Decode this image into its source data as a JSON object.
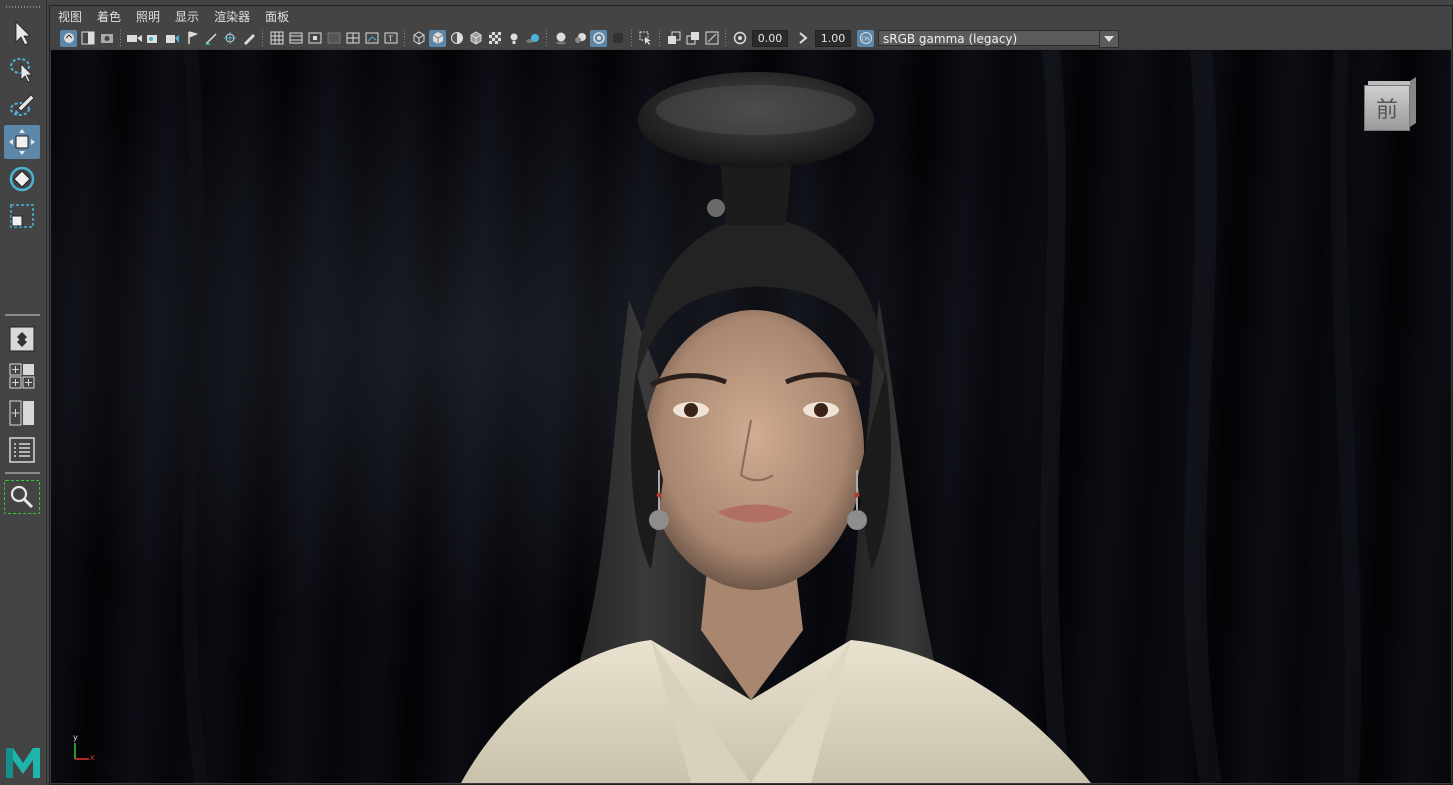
{
  "menu": {
    "items": [
      "视图",
      "着色",
      "照明",
      "显示",
      "渲染器",
      "面板"
    ]
  },
  "toolbar": {
    "exposure_value": "0.00",
    "gamma_value": "1.00",
    "colorspace": "sRGB gamma (legacy)"
  },
  "viewport": {
    "view_cube_label": "前",
    "axis_labels": {
      "x": "x",
      "y": "y"
    }
  },
  "colors": {
    "panel_bg": "#444444",
    "active_tool": "#5d87a8",
    "viewport_bg": "#05060a",
    "maya_logo": "#1fb5ac"
  },
  "icons": {
    "left_toolbox": [
      "select-icon",
      "lasso-select-icon",
      "paint-select-icon",
      "move-icon",
      "rotate-icon",
      "scale-icon",
      "single-view-icon",
      "four-view-icon",
      "two-view-icon",
      "outliner-icon",
      "zoom-icon"
    ]
  }
}
